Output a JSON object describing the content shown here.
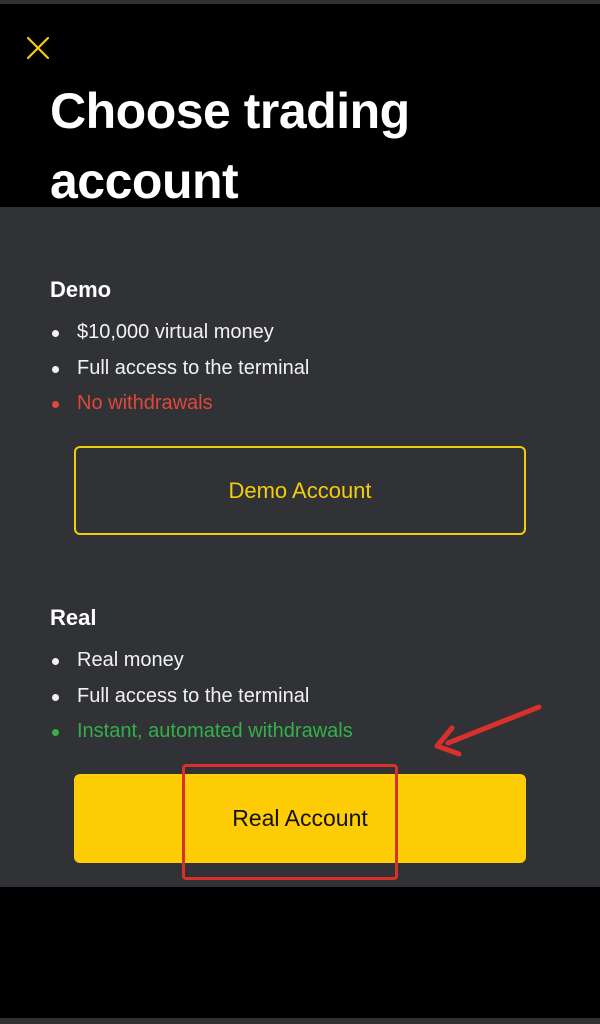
{
  "colors": {
    "accent_yellow": "#fecd05",
    "panel_background": "#303235",
    "header_background": "#000000",
    "negative_red": "#e2473a",
    "positive_green": "#34b04b",
    "annotation_red": "#d8302a"
  },
  "header": {
    "close_icon": "close-icon",
    "title_line1": "Choose trading",
    "title_line2": "account"
  },
  "demo": {
    "title": "Demo",
    "features": [
      "$10,000 virtual money",
      "Full access to the terminal",
      "No withdrawals"
    ],
    "button_label": "Demo Account"
  },
  "real": {
    "title": "Real",
    "features": [
      "Real money",
      "Full access to the terminal",
      "Instant, automated withdrawals"
    ],
    "button_label": "Real Account"
  },
  "annotation": {
    "arrow_icon": "arrow-icon"
  }
}
